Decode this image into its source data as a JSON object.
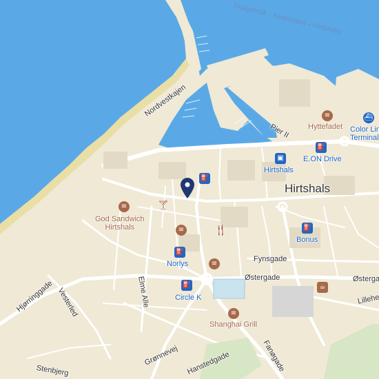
{
  "map": {
    "city": "Hirtshals",
    "water_label": "Skagerrak - Kvansand - Hirtshals",
    "pin_name": "location-pin",
    "colors": {
      "water": "#5aa9e6",
      "land": "#efe9d6",
      "beach": "#e9dea5",
      "road": "#ffffff",
      "food": "#a8684a",
      "transit": "#2066c4"
    },
    "pois": [
      {
        "label": "God Sandwich\nHirtshals",
        "category": "food",
        "icon": "burger-icon"
      },
      {
        "label": "Hyttefadet",
        "category": "food",
        "icon": "burger-icon"
      },
      {
        "label": "Shanghai Grill",
        "category": "food",
        "icon": "burger-icon"
      },
      {
        "label": "Norlys",
        "category": "fuel",
        "icon": "fuel-icon"
      },
      {
        "label": "Circle K",
        "category": "fuel",
        "icon": "fuel-icon"
      },
      {
        "label": "E.ON Drive",
        "category": "fuel",
        "icon": "fuel-icon"
      },
      {
        "label": "Bonus",
        "category": "fuel",
        "icon": "fuel-icon"
      },
      {
        "label": "Hirtshals",
        "category": "transit",
        "icon": "train-icon"
      },
      {
        "label": "Color Line\nTerminal",
        "category": "transit",
        "icon": "ferry-icon"
      }
    ],
    "unlabeled_icons": [
      "cocktail-icon",
      "restaurant-icon",
      "burger-icon",
      "fuel-icon",
      "burger-icon",
      "coffee-icon",
      "burger-icon"
    ],
    "streets": [
      "Nordvestkajen",
      "Pier II",
      "Fynsgade",
      "Østergade",
      "Østergade",
      "Lilleheden",
      "Hjørringgade",
      "Vesterled",
      "Elme Alle",
      "Hanstedgade",
      "Fanøgade",
      "Grønnevej",
      "Stenbjerg"
    ]
  }
}
